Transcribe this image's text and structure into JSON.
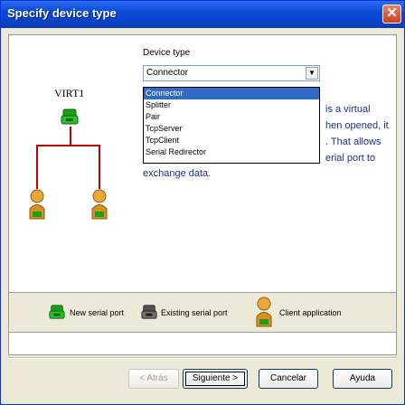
{
  "window": {
    "title": "Specify device type",
    "close_label": "✕"
  },
  "device_type": {
    "label": "Device type",
    "selected": "Connector",
    "options": [
      "Connector",
      "Splitter",
      "Pair",
      "TcpServer",
      "TcpClient",
      "Serial Redirector"
    ]
  },
  "diagram": {
    "root_label": "VIRT1"
  },
  "description": {
    "line1": "is a virtual",
    "line2": "hen opened, it",
    "line3": ". That allows",
    "line4": "erial port to",
    "line5": "exchange data."
  },
  "legend": {
    "new_port": "New serial port",
    "existing_port": "Existing serial port",
    "client_app": "Client application"
  },
  "buttons": {
    "back": "< Atrás",
    "next": "Siguiente >",
    "cancel": "Cancelar",
    "help": "Ayuda"
  },
  "colors": {
    "connector_line": "#c00000",
    "new_port": "#18a018",
    "existing_port": "#505050",
    "selection": "#316ac5"
  }
}
